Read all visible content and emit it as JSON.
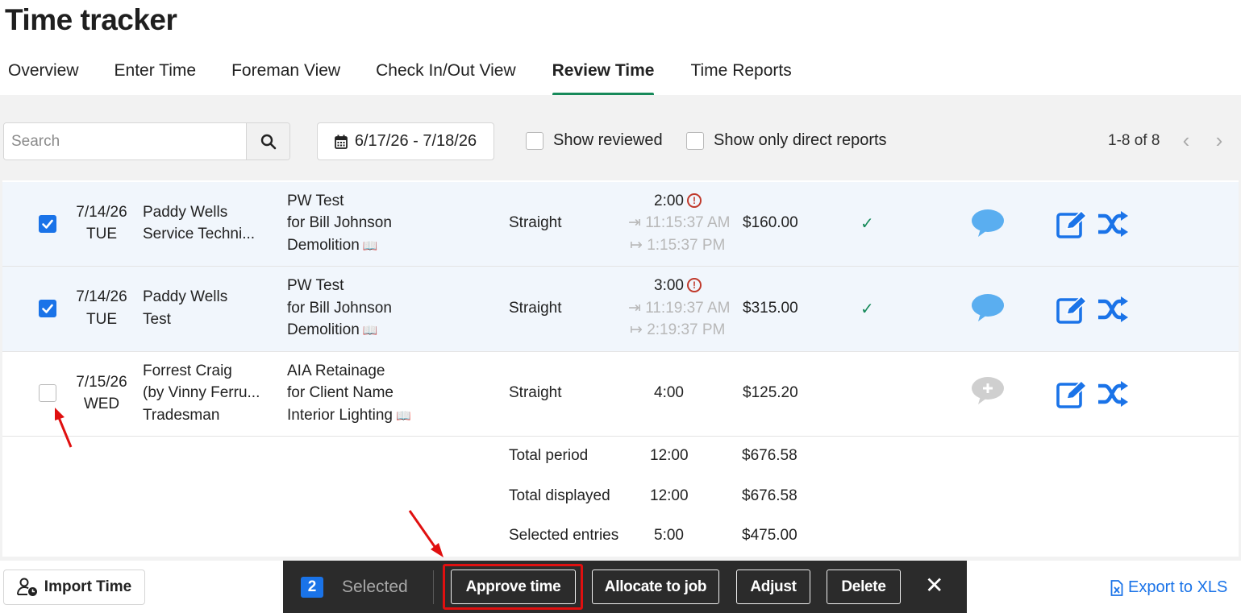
{
  "header": {
    "title": "Time tracker"
  },
  "tabs": [
    {
      "label": "Overview"
    },
    {
      "label": "Enter Time"
    },
    {
      "label": "Foreman View"
    },
    {
      "label": "Check In/Out View"
    },
    {
      "label": "Review Time",
      "active": true
    },
    {
      "label": "Time Reports"
    }
  ],
  "toolbar": {
    "search_placeholder": "Search",
    "date_range": "6/17/26 - 7/18/26",
    "show_reviewed_label": "Show reviewed",
    "show_direct_reports_label": "Show only direct reports",
    "pagination": "1-8 of 8"
  },
  "rows": [
    {
      "selected": true,
      "date": "7/14/26",
      "day": "TUE",
      "person": "Paddy Wells",
      "person_sub": "Service Techni...",
      "job_line1": "PW Test",
      "job_line2": "for Bill Johnson",
      "job_line3": "Demolition",
      "type": "Straight",
      "hours": "2:00",
      "check_in": "11:15:37 AM",
      "check_out": "1:15:37 PM",
      "amount": "$160.00",
      "approved": true,
      "has_comment": true
    },
    {
      "selected": true,
      "date": "7/14/26",
      "day": "TUE",
      "person": "Paddy Wells",
      "person_sub": "Test",
      "job_line1": "PW Test",
      "job_line2": "for Bill Johnson",
      "job_line3": "Demolition",
      "type": "Straight",
      "hours": "3:00",
      "check_in": "11:19:37 AM",
      "check_out": "2:19:37 PM",
      "amount": "$315.00",
      "approved": true,
      "has_comment": true
    },
    {
      "selected": false,
      "date": "7/15/26",
      "day": "WED",
      "person": "Forrest Craig",
      "person_sub": "(by Vinny Ferru...",
      "person_sub2": "Tradesman",
      "job_line1": "AIA Retainage",
      "job_line2": "for Client Name",
      "job_line3": "Interior Lighting",
      "type": "Straight",
      "hours": "4:00",
      "amount": "$125.20",
      "approved": false,
      "has_comment": false
    }
  ],
  "totals": [
    {
      "label": "Total period",
      "hours": "12:00",
      "amount": "$676.58"
    },
    {
      "label": "Total displayed",
      "hours": "12:00",
      "amount": "$676.58"
    },
    {
      "label": "Selected entries",
      "hours": "5:00",
      "amount": "$475.00"
    }
  ],
  "footer": {
    "import_label": "Import Time",
    "export_label": "Export to XLS"
  },
  "action_bar": {
    "count": "2",
    "selected_label": "Selected",
    "approve_label": "Approve time",
    "allocate_label": "Allocate to job",
    "adjust_label": "Adjust",
    "delete_label": "Delete",
    "close_glyph": "✕"
  },
  "colors": {
    "accent": "#1a73e8",
    "tab_underline": "#178a5a",
    "warning": "#c0392b",
    "annotation": "#e01010"
  }
}
